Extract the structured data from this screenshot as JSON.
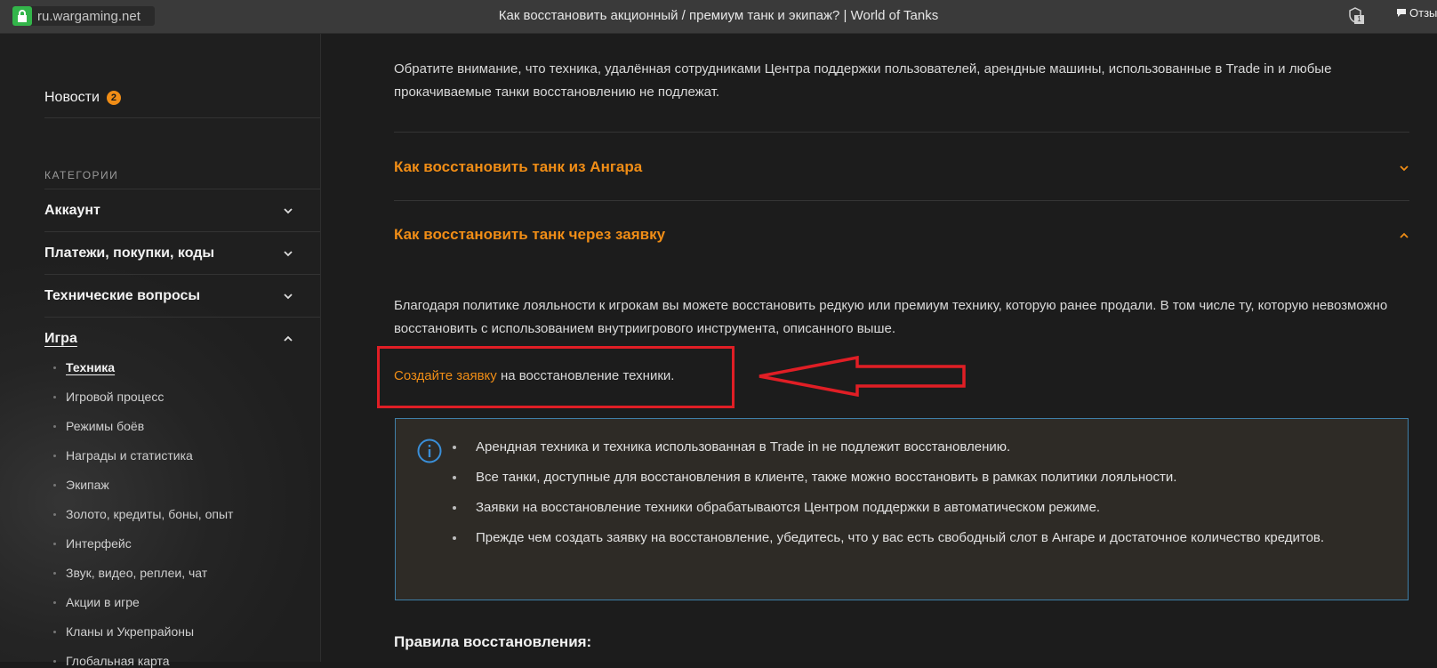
{
  "topbar": {
    "site": "ru.wargaming.net",
    "title": "Как восстановить акционный / премиум танк и экипаж? | World of Tanks",
    "ext_badge": "1",
    "feedback": "Отзы"
  },
  "sidebar": {
    "news_label": "Новости",
    "news_count": "2",
    "categories_heading": "КАТЕГОРИИ",
    "categories": [
      {
        "label": "Аккаунт"
      },
      {
        "label": "Платежи, покупки, коды"
      },
      {
        "label": "Технические вопросы"
      },
      {
        "label": "Игра"
      }
    ],
    "subitems": [
      {
        "label": "Техника"
      },
      {
        "label": "Игровой процесс"
      },
      {
        "label": "Режимы боёв"
      },
      {
        "label": "Награды и статистика"
      },
      {
        "label": "Экипаж"
      },
      {
        "label": "Золото, кредиты, боны, опыт"
      },
      {
        "label": "Интерфейс"
      },
      {
        "label": "Звук, видео, реплеи, чат"
      },
      {
        "label": "Акции в игре"
      },
      {
        "label": "Кланы и Укрепрайоны"
      },
      {
        "label": "Глобальная карта"
      }
    ]
  },
  "main": {
    "intro": "Обратите внимание, что техника, удалённая сотрудниками Центра поддержки пользователей, арендные машины, использованные в Trade in и любые прокачиваемые танки восстановлению не подлежат.",
    "accordion": [
      {
        "title": "Как восстановить танк из Ангара",
        "state": "collapsed"
      },
      {
        "title": "Как восстановить танк через заявку",
        "state": "expanded"
      }
    ],
    "body": "Благодаря политике лояльности к игрокам вы можете восстановить редкую или премиум технику, которую ранее продали. В том числе ту, которую невозможно восстановить с использованием внутриигрового инструмента, описанного выше.",
    "request_link": "Создайте заявку",
    "request_rest": " на восстановление техники.",
    "info_items": [
      "Арендная техника и техника использованная в Trade in не подлежит восстановлению.",
      "Все танки, доступные для восстановления в клиенте, также можно восстановить в рамках политики лояльности.",
      "Заявки на восстановление техники обрабатываются Центром поддержки в автоматическом режиме.",
      "Прежде чем создать заявку на восстановление, убедитесь, что у вас есть свободный слот в Ангаре и достаточное количество кредитов."
    ],
    "rules_title": "Правила восстановления:"
  },
  "colors": {
    "accent": "#f08d16",
    "annotation": "#e01e25",
    "info_border": "#3f7fa8",
    "secure": "#33b54a"
  }
}
